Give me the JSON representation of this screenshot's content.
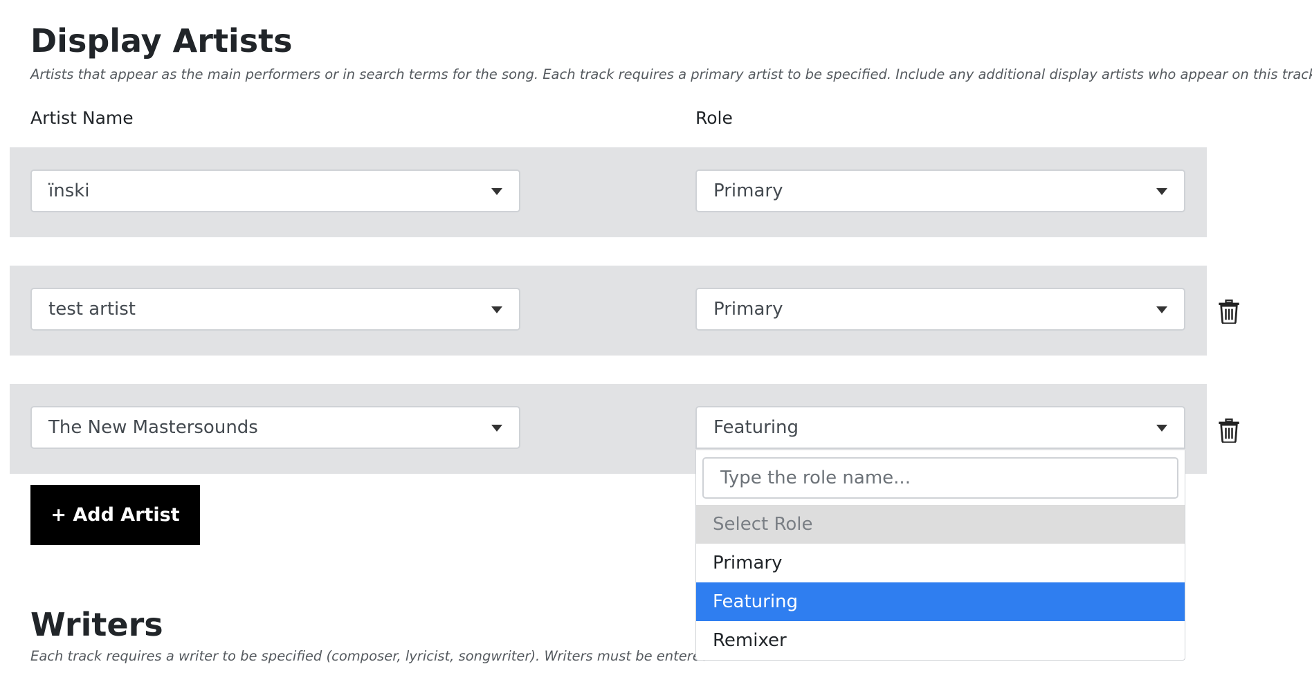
{
  "display_artists": {
    "title": "Display Artists",
    "description": "Artists that appear as the main performers or in search terms for the song. Each track requires a primary artist to be specified. Include any additional display artists who appear on this track.",
    "column_artist_label": "Artist Name",
    "column_role_label": "Role",
    "rows": [
      {
        "artist": "ïnski",
        "role": "Primary",
        "removable": false
      },
      {
        "artist": "test artist",
        "role": "Primary",
        "removable": true
      },
      {
        "artist": "The New Mastersounds",
        "role": "Featuring",
        "removable": true
      }
    ],
    "add_button_label": "+ Add Artist"
  },
  "role_dropdown": {
    "search_placeholder": "Type the role name...",
    "options": [
      {
        "label": "Select Role",
        "state": "disabled"
      },
      {
        "label": "Primary",
        "state": "normal"
      },
      {
        "label": "Featuring",
        "state": "selected"
      },
      {
        "label": "Remixer",
        "state": "normal"
      }
    ]
  },
  "writers": {
    "title": "Writers",
    "description_visible": "Each track requires a writer to be specified (composer, lyricist, songwriter). Writers must be entered"
  },
  "icons": {
    "caret": "caret-down-icon",
    "trash": "trash-icon"
  },
  "colors": {
    "row_background": "#e1e2e4",
    "selected_option": "#2f7ef0",
    "disabled_option": "#dddddd",
    "add_button": "#000000"
  }
}
